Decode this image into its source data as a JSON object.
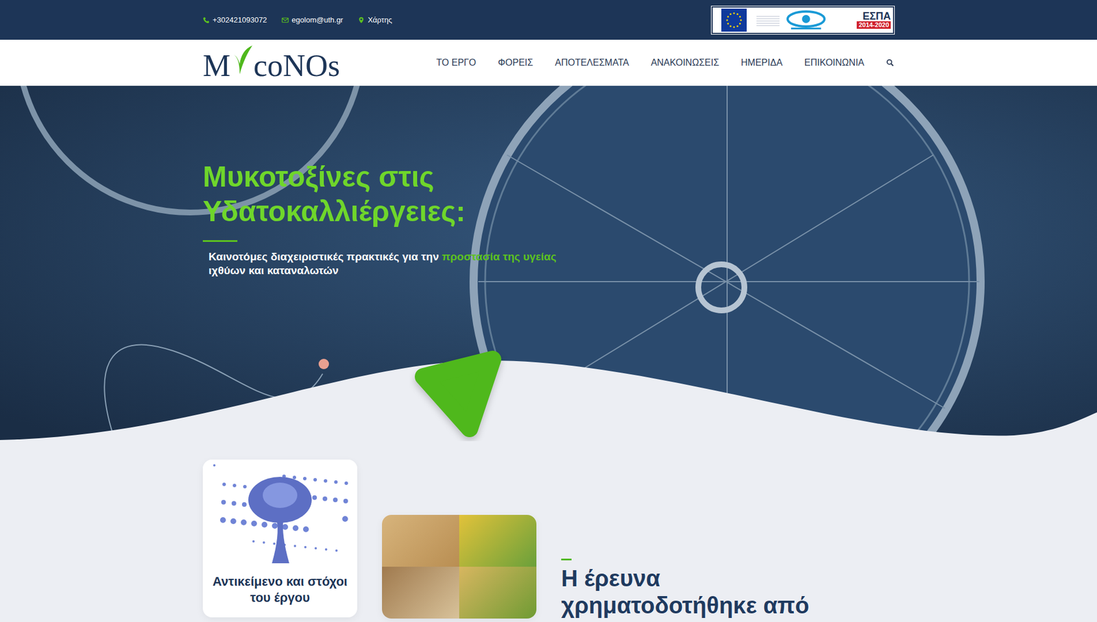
{
  "topbar": {
    "contacts": [
      {
        "kind": "phone",
        "text": "+302421093072"
      },
      {
        "kind": "email",
        "text": "egolom@uth.gr"
      },
      {
        "kind": "location",
        "text": "Χάρτης"
      }
    ],
    "sponsor_logos": {
      "espa_title": "ΕΣΠΑ",
      "espa_years": "2014-2020"
    }
  },
  "logo": {
    "before": "M",
    "after": "coNOs"
  },
  "nav": {
    "items": [
      {
        "label": "ΤΟ ΕΡΓΟ",
        "selected": false
      },
      {
        "label": "ΦΟΡΕΙΣ",
        "selected": false
      },
      {
        "label": "ΑΠΟΤΕΛΕΣΜΑΤΑ",
        "selected": false
      },
      {
        "label": "ΑΝΑΚΟΙΝΩΣΕΙΣ",
        "selected": false
      },
      {
        "label": "ΗΜΕΡΙΔΑ",
        "selected": false
      },
      {
        "label": "ΕΠΙΚΟΙΝΩΝΙΑ",
        "selected": false
      }
    ]
  },
  "hero": {
    "title_lines": [
      "Μυκοτοξίνες στις",
      "Υδατοκαλλιέργειες:"
    ],
    "subtitle": {
      "before": "Καινοτόμες διαχειριστικές πρακτικές για την ",
      "highlight": "προστασία της υγείας",
      "after": " ιχθύων και καταναλωτών"
    }
  },
  "cards": [
    {
      "kind": "fungus",
      "title": "Αντικείμενο και στόχοι του έργου"
    },
    {
      "kind": "grains",
      "title": ""
    }
  ],
  "funding": {
    "heading": "Η έρευνα χρηματοδοτήθηκε από"
  }
}
